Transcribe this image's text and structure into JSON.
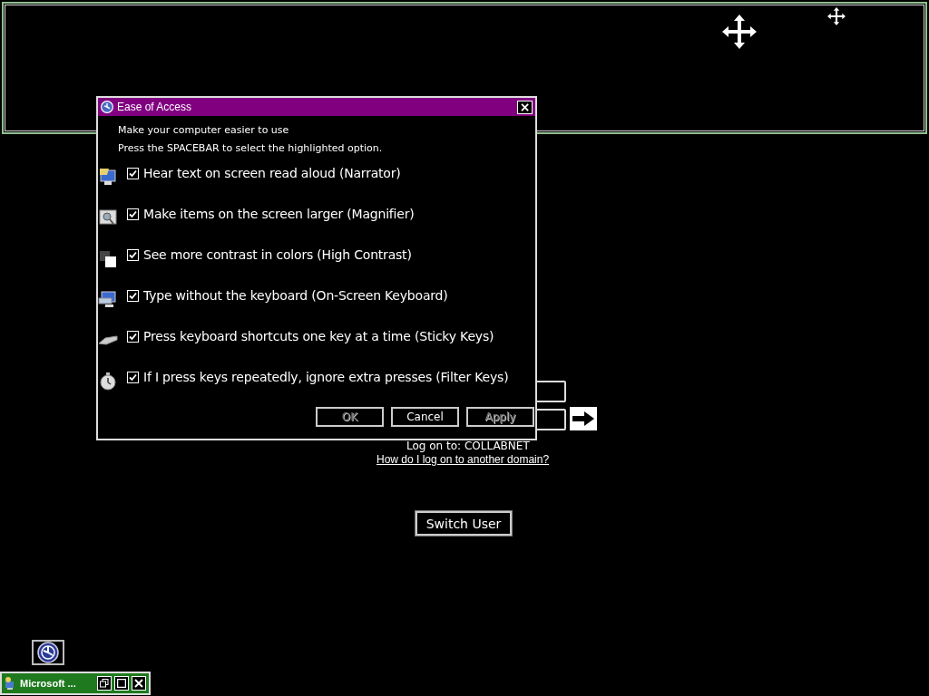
{
  "dialog": {
    "title": "Ease of Access",
    "close": "×",
    "heading": "Make your computer easier to use",
    "hint": "Press the SPACEBAR to select the highlighted option.",
    "options": [
      {
        "label": "Hear text on screen read aloud (Narrator)",
        "checked": true
      },
      {
        "label": "Make items on the screen larger (Magnifier)",
        "checked": true
      },
      {
        "label": "See more contrast in colors (High Contrast)",
        "checked": true
      },
      {
        "label": "Type without the keyboard (On-Screen Keyboard)",
        "checked": true
      },
      {
        "label": "Press keyboard shortcuts one key at a time (Sticky Keys)",
        "checked": true
      },
      {
        "label": "If I press keys repeatedly, ignore extra presses (Filter Keys)",
        "checked": true
      }
    ],
    "buttons": [
      {
        "label": "OK",
        "disabled": true
      },
      {
        "label": "Cancel",
        "disabled": false
      },
      {
        "label": "Apply",
        "disabled": true
      }
    ]
  },
  "logon": {
    "domain": "Log on to: COLLABNET",
    "link": "How do I log on to another domain?",
    "switch_user": "Switch User"
  },
  "taskbar": {
    "title": "Microsoft ..."
  }
}
